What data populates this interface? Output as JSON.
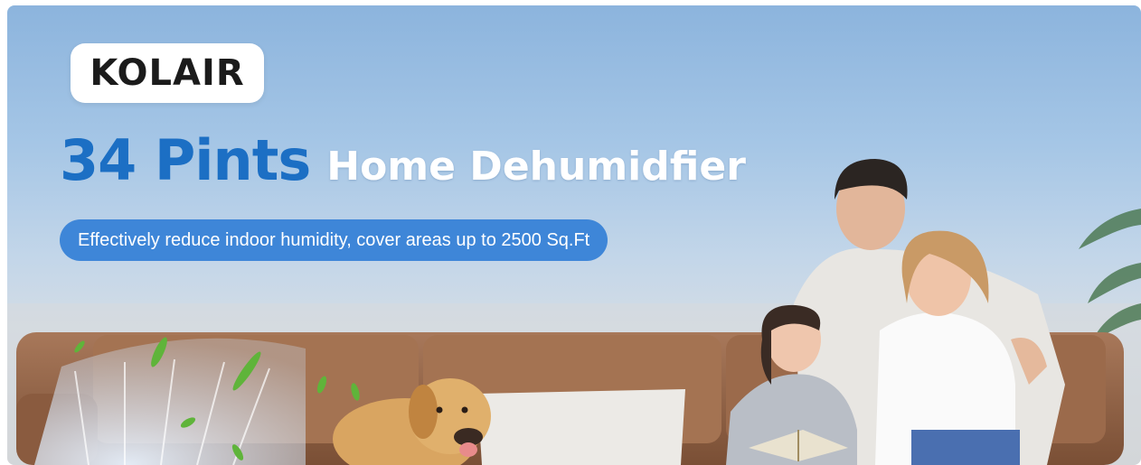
{
  "brand": {
    "logo_text": "KOLAIR",
    "accent_color": "#1c6fc4",
    "logo_accent_colors": [
      "#1c6fc4",
      "#f29a1f"
    ]
  },
  "headline": {
    "strong": "34 Pints",
    "rest": "Home Dehumidfier"
  },
  "tagline": "Effectively reduce indoor humidity, cover areas up to 2500 Sq.Ft",
  "colors": {
    "sky": "#8cb4dd",
    "pill": "#3e86d8",
    "sofa": "#9a6a4a"
  }
}
